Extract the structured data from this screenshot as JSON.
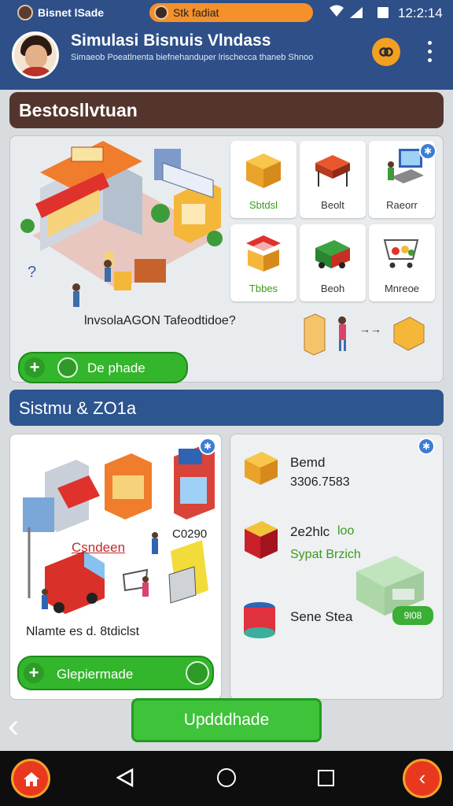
{
  "status_bar": {
    "app_name": "Bisnet lSade",
    "notification_text": "Stk fadiat",
    "time": "12:2:14",
    "icons": [
      "wifi-icon",
      "signal-icon",
      "battery-icon"
    ]
  },
  "header": {
    "title": "Simulasi Bisnuis Vlndass",
    "subtitle": "Simaeob Poeatlnenta biefnehanduper lrischecca thaneb Shnoo",
    "action_icon": "link-icon",
    "menu_icon": "more-vertical-icon",
    "brand_color": "#2e4f88",
    "accent_color": "#f2a021"
  },
  "section1": {
    "title": "Bestosllvtuan",
    "grid": [
      {
        "label": "Sbtdsl",
        "icon": "box-icon",
        "style": "green"
      },
      {
        "label": "Beolt",
        "icon": "cart-table-icon",
        "style": "plain"
      },
      {
        "label": "Raeorr",
        "icon": "computer-desk-icon",
        "style": "plain"
      },
      {
        "label": "Tbbes",
        "icon": "market-stall-icon",
        "style": "green"
      },
      {
        "label": "Beoh",
        "icon": "truck-icon",
        "style": "plain"
      },
      {
        "label": "Mnreoe",
        "icon": "shopping-cart-icon",
        "style": "plain"
      }
    ],
    "caption": "lnvsolaAGON Tafeodtidoe?",
    "question_mark": "?",
    "button_label": "De phade"
  },
  "section2": {
    "title": "Sistmu & ZO1a",
    "left_panel": {
      "red_label": "Csndeen",
      "code_label": "C0290",
      "caption": "Nlamte es d. 8tdiclst",
      "button_label": "Glepiermade"
    },
    "right_panel": {
      "items": [
        {
          "name": "Bemd",
          "value": "3306.7583",
          "icon": "crate-icon"
        },
        {
          "name": "2e2hlc",
          "green_name": "loo",
          "value": "Sypat Brzich",
          "icon": "red-crate-icon"
        },
        {
          "name": "Sene Stea",
          "icon": "barrel-icon"
        }
      ],
      "badge": "9l08"
    }
  },
  "update_button": "Updddhade",
  "navbar": {
    "icons": [
      "home-icon",
      "nav-back-icon",
      "nav-home-icon",
      "nav-recents-icon",
      "chevron-left-icon"
    ]
  }
}
